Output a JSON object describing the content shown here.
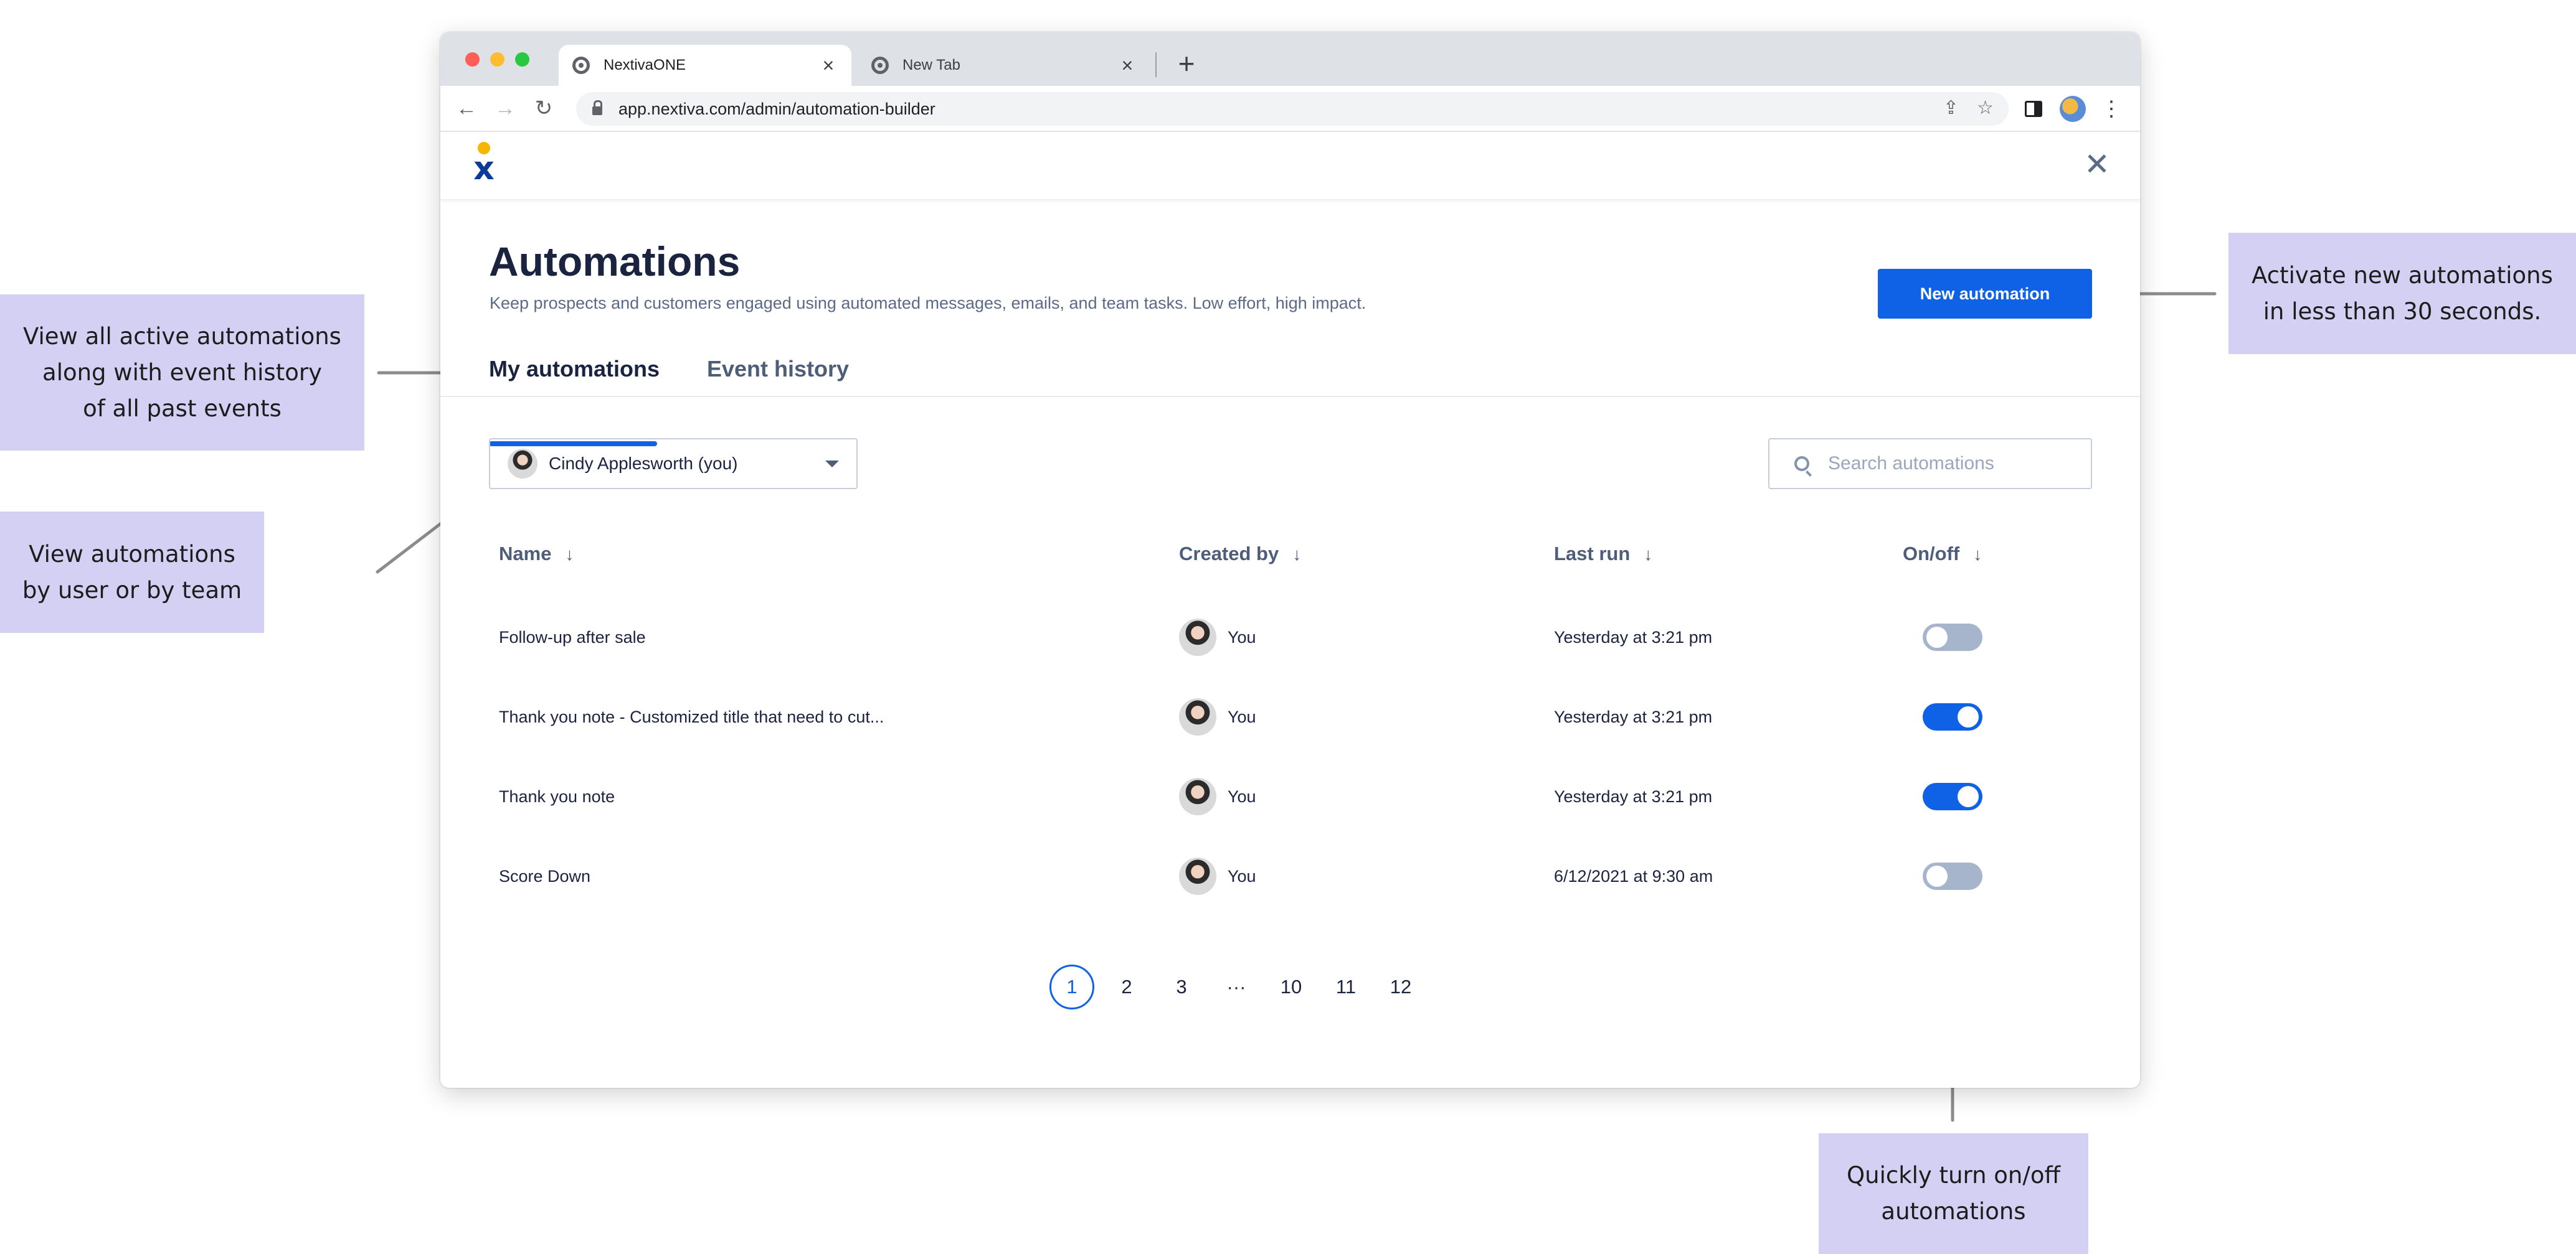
{
  "callouts": {
    "history": "View all active automations\nalong with event history\nof all past events",
    "by_user": "View automations\nby user or by team",
    "new_automation": "Activate new automations\nin less than 30 seconds.",
    "toggle": "Quickly turn on/off\nautomations"
  },
  "browser": {
    "tabs": [
      {
        "title": "NextivaONE",
        "icon": "browser-favicon-icon"
      },
      {
        "title": "New Tab",
        "icon": "browser-favicon-icon"
      }
    ],
    "new_tab_glyph": "+",
    "url": "app.nextiva.com/admin/automation-builder",
    "nav_icons": {
      "back": "←",
      "forward": "→",
      "reload": "↻",
      "share": "⇪",
      "star": "☆",
      "menu": "⋮"
    }
  },
  "app": {
    "logo_glyph": "x",
    "close_glyph": "✕"
  },
  "page": {
    "title": "Automations",
    "subtitle": "Keep prospects and customers engaged using automated messages, emails, and team tasks. Low effort, high impact.",
    "new_button": "New automation",
    "tabs": [
      "My automations",
      "Event history"
    ],
    "owner_filter": "Cindy Applesworth (you)",
    "search_placeholder": "Search automations"
  },
  "table": {
    "columns": [
      "Name",
      "Created by",
      "Last run",
      "On/off"
    ],
    "sort_glyph": "↓",
    "rows": [
      {
        "name": "Follow-up after sale",
        "created_by": "You",
        "last_run": "Yesterday at 3:21 pm",
        "on": false
      },
      {
        "name": "Thank you note - Customized title that need to cut...",
        "created_by": "You",
        "last_run": "Yesterday at 3:21 pm",
        "on": true
      },
      {
        "name": "Thank you note",
        "created_by": "You",
        "last_run": "Yesterday at 3:21 pm",
        "on": true
      },
      {
        "name": "Score Down",
        "created_by": "You",
        "last_run": "6/12/2021 at 9:30 am",
        "on": false
      }
    ]
  },
  "pagination": {
    "pages": [
      "1",
      "2",
      "3",
      "···",
      "10",
      "11",
      "12"
    ],
    "current": "1"
  },
  "colors": {
    "accent": "#0f62e6",
    "callout_bg": "#d3d0f4",
    "toggle_off": "#a6b5cc",
    "heading": "#1a2440"
  }
}
